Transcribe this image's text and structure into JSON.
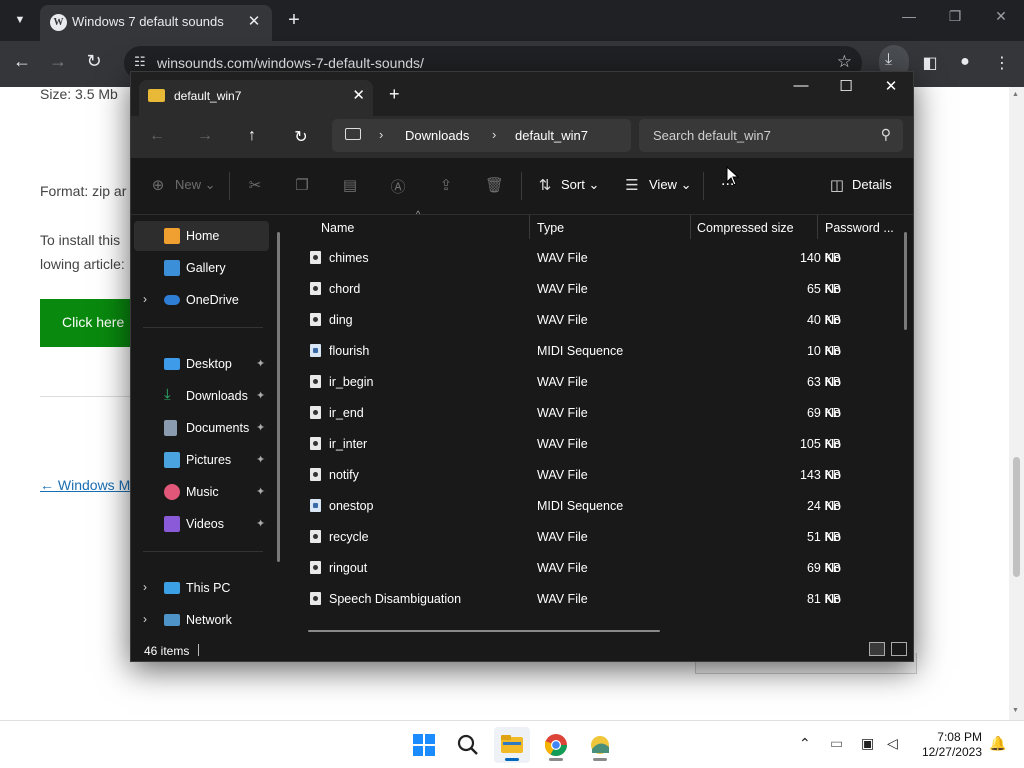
{
  "browser": {
    "tab_title": "Windows 7 default sounds",
    "url": "winsounds.com/windows-7-default-sounds/"
  },
  "webpage": {
    "size_text": "Size: 3.5 Mb",
    "format_text": "Format: zip ar",
    "install_text": "To install this",
    "install_text_2": "lowing article:",
    "click_here": "Click here",
    "prev_link": "← Windows M"
  },
  "explorer": {
    "tab_title": "default_win7",
    "breadcrumbs": [
      "Downloads",
      "default_win7"
    ],
    "search_placeholder": "Search default_win7",
    "commands": {
      "new": "New",
      "sort": "Sort",
      "view": "View",
      "more": "...",
      "details": "Details"
    },
    "sidebar": {
      "home": "Home",
      "gallery": "Gallery",
      "onedrive": "OneDrive",
      "pinned": [
        "Desktop",
        "Downloads",
        "Documents",
        "Pictures",
        "Music",
        "Videos"
      ],
      "thispc": "This PC",
      "network": "Network"
    },
    "columns": [
      "Name",
      "Type",
      "Compressed size",
      "Password ..."
    ],
    "files": [
      {
        "name": "chimes",
        "type": "WAV File",
        "size": "140 KB",
        "pw": "No"
      },
      {
        "name": "chord",
        "type": "WAV File",
        "size": "65 KB",
        "pw": "No"
      },
      {
        "name": "ding",
        "type": "WAV File",
        "size": "40 KB",
        "pw": "No"
      },
      {
        "name": "flourish",
        "type": "MIDI Sequence",
        "size": "10 KB",
        "pw": "No"
      },
      {
        "name": "ir_begin",
        "type": "WAV File",
        "size": "63 KB",
        "pw": "No"
      },
      {
        "name": "ir_end",
        "type": "WAV File",
        "size": "69 KB",
        "pw": "No"
      },
      {
        "name": "ir_inter",
        "type": "WAV File",
        "size": "105 KB",
        "pw": "No"
      },
      {
        "name": "notify",
        "type": "WAV File",
        "size": "143 KB",
        "pw": "No"
      },
      {
        "name": "onestop",
        "type": "MIDI Sequence",
        "size": "24 KB",
        "pw": "No"
      },
      {
        "name": "recycle",
        "type": "WAV File",
        "size": "51 KB",
        "pw": "No"
      },
      {
        "name": "ringout",
        "type": "WAV File",
        "size": "69 KB",
        "pw": "No"
      },
      {
        "name": "Speech Disambiguation",
        "type": "WAV File",
        "size": "81 KB",
        "pw": "No"
      }
    ],
    "status_count": "46 items"
  },
  "taskbar": {
    "time": "7:08 PM",
    "date": "12/27/2023"
  },
  "colors": {
    "explorer_bg": "#191919",
    "accent": "#0067c0",
    "green_button": "#09890e"
  }
}
